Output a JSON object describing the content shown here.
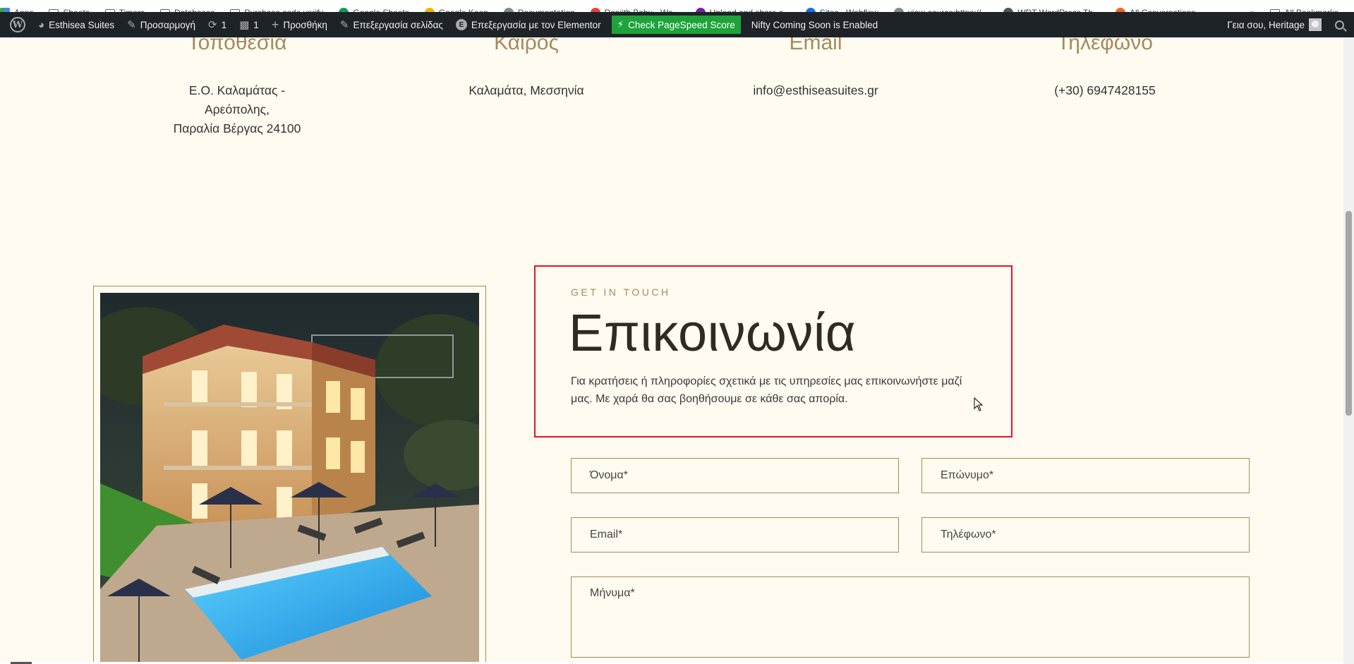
{
  "bookmarks": [
    {
      "label": "Apps",
      "type": "apps"
    },
    {
      "label": "Sheets",
      "type": "folder"
    },
    {
      "label": "Timers",
      "type": "folder"
    },
    {
      "label": "Databases",
      "type": "folder"
    },
    {
      "label": "Purchase code verify",
      "type": "folder"
    },
    {
      "label": "Google Sheets",
      "type": "site",
      "color": "#0f9d58"
    },
    {
      "label": "Google Keep",
      "type": "site",
      "color": "#f4b400"
    },
    {
      "label": "Documentation",
      "type": "site",
      "color": "#888888"
    },
    {
      "label": "Ranjith Babu - We...",
      "type": "site",
      "color": "#e94235"
    },
    {
      "label": "Upload and share s...",
      "type": "site",
      "color": "#7b1fa2"
    },
    {
      "label": "Sites - Webflow",
      "type": "site",
      "color": "#146ef5"
    },
    {
      "label": "view-source:https://...",
      "type": "site",
      "color": "#888888"
    },
    {
      "label": "WDT WordPress Th...",
      "type": "site",
      "color": "#555555"
    },
    {
      "label": "All Conversations",
      "type": "site",
      "color": "#f26522"
    }
  ],
  "bookmarks_more": "»",
  "bookmarks_all": "All Bookmarks",
  "adminbar": {
    "site_name": "Esthisea Suites",
    "customize": "Προσαρμογή",
    "updates_count": "1",
    "comments_count": "1",
    "new": "Προσθήκη",
    "edit_page": "Επεξεργασία σελίδας",
    "edit_elementor": "Επεξεργασία με τον Elementor",
    "pagespeed": "Check PageSpeed Score",
    "nifty": "Nifty Coming Soon is Enabled",
    "greeting": "Γεια σου, Heritage"
  },
  "info": [
    {
      "title": "Τοποθεσία",
      "lines": [
        "Ε.Ο. Καλαμάτας -",
        "Αρεόπολης,",
        "Παραλία Βέργας 24100"
      ]
    },
    {
      "title": "Καιρός",
      "lines": [
        "Καλαμάτα, Μεσσηνία"
      ]
    },
    {
      "title": "Email",
      "lines": [
        "info@esthiseasuites.gr"
      ]
    },
    {
      "title": "Τηλέφωνο",
      "lines": [
        "(+30) 6947428155"
      ]
    }
  ],
  "contact": {
    "eyebrow": "GET IN TOUCH",
    "heading": "Επικοινωνία",
    "description": "Για κρατήσεις ή πληροφορίες σχετικά με τις υπηρεσίες μας επικοινωνήστε μαζί μας. Με χαρά θα σας βοηθήσουμε σε κάθε σας απορία."
  },
  "form": {
    "first_name": "Όνομα*",
    "last_name": "Επώνυμο*",
    "email": "Email*",
    "phone": "Τηλέφωνο*",
    "message": "Μήνυμα*"
  },
  "colors": {
    "page_bg": "#fffbf0",
    "accent_gold": "#a68a5e",
    "heading_dark": "#2f2b1e",
    "adminbar_bg": "#1d2327",
    "pagespeed_green": "#1ea33a",
    "highlight_red": "#e81123"
  }
}
